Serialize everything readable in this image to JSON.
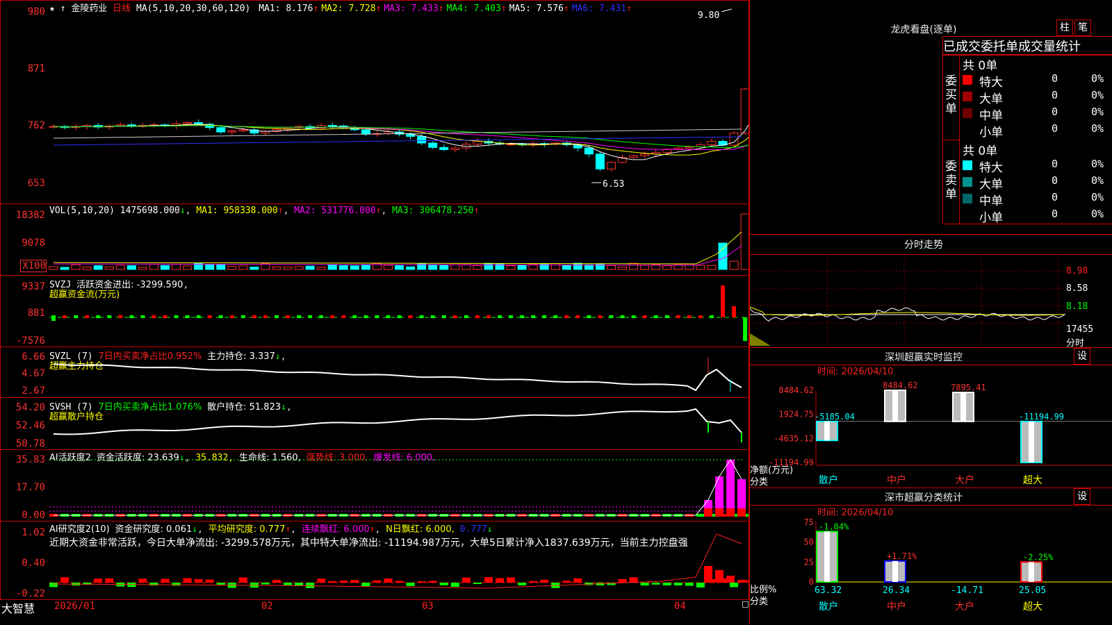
{
  "stock": {
    "name": "金陵药业",
    "period": "日线"
  },
  "price_panel": {
    "ma_label": "MA(5,10,20,30,60,120)",
    "ma": [
      {
        "label": "MA1:",
        "value": "8.176",
        "color": "#ffffff"
      },
      {
        "label": "MA2:",
        "value": "7.728",
        "color": "#ffff00"
      },
      {
        "label": "MA3:",
        "value": "7.433",
        "color": "#ff00ff"
      },
      {
        "label": "MA4:",
        "value": "7.403",
        "color": "#00ff00"
      },
      {
        "label": "MA5:",
        "value": "7.576",
        "color": "#ffffff"
      },
      {
        "label": "MA6:",
        "value": "7.431",
        "color": "#3030ff"
      }
    ],
    "y_ticks": [
      "980",
      "871",
      "762",
      "653"
    ],
    "high_label": "9.80",
    "low_label": "6.53"
  },
  "vol_panel": {
    "label": "VOL(5,10,20)",
    "value": "1475698.000",
    "ma1": "MA1: 958338.000",
    "ma2": "MA2: 531776.000",
    "ma3": "MA3: 306478.250",
    "y_ticks": [
      "18382",
      "9078",
      "X100"
    ]
  },
  "svzj_panel": {
    "label": "SVZJ",
    "text": "活跃资金进出: -3299.590",
    "subtitle": "超赢资金流(万元)",
    "y_ticks": [
      "9337",
      "881",
      "-7576"
    ]
  },
  "svzl_panel": {
    "label": "SVZL (7)",
    "text1": "7日内买卖净占比0.952%",
    "text2": "主力持仓: 3.337",
    "subtitle": "超赢主力持仓",
    "y_ticks": [
      "6.66",
      "4.67",
      "2.67"
    ]
  },
  "svsh_panel": {
    "label": "SVSH (7)",
    "text1": "7日内买卖净占比1.076%",
    "text2": "散户持仓: 51.823",
    "subtitle": "超赢散户持仓",
    "y_ticks": [
      "54.20",
      "52.46",
      "50.78"
    ]
  },
  "ai_panel": {
    "label": "AI活跃度2",
    "t1": "资金活跃度: 23.639",
    "t2": "35.832,",
    "t3": "生命线: 1.560,",
    "t4": "强势线: 3.000,",
    "t5": "爆发线: 6.000,",
    "y_ticks": [
      "35.83",
      "17.70",
      "0.00"
    ]
  },
  "ai_research": {
    "label": "AI研究度2(10)",
    "t1": "资金研究度: 0.061",
    "t2": "平均研究度: 0.777",
    "t3": "连续飘红: 6.000",
    "t4": "N日飘红: 6.000,",
    "t5": "0.777",
    "desc": "近期大资金非常活跃，今日大单净流出: -3299.578万元，其中特大单净流出: -11194.987万元，大单5日累计净入1837.639万元，当前主力控盘强",
    "y_ticks": [
      "1.02",
      "0.40",
      "-0.22"
    ]
  },
  "x_axis": {
    "labels": [
      "2026/01",
      "02",
      "03",
      "04"
    ]
  },
  "brand": "大智慧",
  "lhb": {
    "title": "龙虎看盘(逐单)",
    "btn1": "柱",
    "btn2": "笔",
    "subtitle": "已成交委托单成交量统计",
    "buy_title": "委买单",
    "sell_title": "委卖单",
    "buy_total": "共 0单",
    "sell_total": "共 0单",
    "buy_rows": [
      {
        "name": "特大",
        "count": "0",
        "pct": "0%",
        "color": "#ff0000"
      },
      {
        "name": "大单",
        "count": "0",
        "pct": "0%",
        "color": "#a00000"
      },
      {
        "name": "中单",
        "count": "0",
        "pct": "0%",
        "color": "#700000"
      },
      {
        "name": "小单",
        "count": "0",
        "pct": "0%",
        "color": "#000000"
      }
    ],
    "sell_rows": [
      {
        "name": "特大",
        "count": "0",
        "pct": "0%",
        "color": "#00ffff"
      },
      {
        "name": "大单",
        "count": "0",
        "pct": "0%",
        "color": "#009090"
      },
      {
        "name": "中单",
        "count": "0",
        "pct": "0%",
        "color": "#006868"
      },
      {
        "name": "小单",
        "count": "0",
        "pct": "0%",
        "color": "#000000"
      }
    ]
  },
  "intraday": {
    "title": "分时走势",
    "y_ticks": [
      "8.98",
      "8.58",
      "8.18"
    ],
    "vol_tick": "17455",
    "unit": "分时"
  },
  "monitor": {
    "title": "深圳超赢实时监控",
    "settings": "设",
    "time": "时间: 2026/04/10",
    "y_ticks": [
      "8484.62",
      "1924.75",
      "-4635.12",
      "-11194.99"
    ],
    "y_unit1": "净额(万元)",
    "y_unit2": "分类",
    "categories": [
      "散户",
      "中户",
      "大户",
      "超大"
    ],
    "values": [
      -5185.04,
      8484.62,
      7895.41,
      -11194.99
    ],
    "labels": [
      "-5185.04",
      "8484.62",
      "7895.41",
      "-11194.99"
    ]
  },
  "classify": {
    "title": "深市超赢分类统计",
    "settings": "设",
    "time": "时间: 2026/04/10",
    "y_ticks": [
      "75",
      "50",
      "25",
      "0"
    ],
    "y_unit1": "比例%",
    "y_unit2": "分类",
    "categories": [
      "散户",
      "中户",
      "大户",
      "超大"
    ],
    "values": [
      63.32,
      26.34,
      -14.71,
      25.05
    ],
    "value_labels": [
      "63.32",
      "26.34",
      "-14.71",
      "25.05"
    ],
    "change_labels": [
      "-1.04%",
      "+1.71%",
      "",
      "-2.25%"
    ]
  }
}
